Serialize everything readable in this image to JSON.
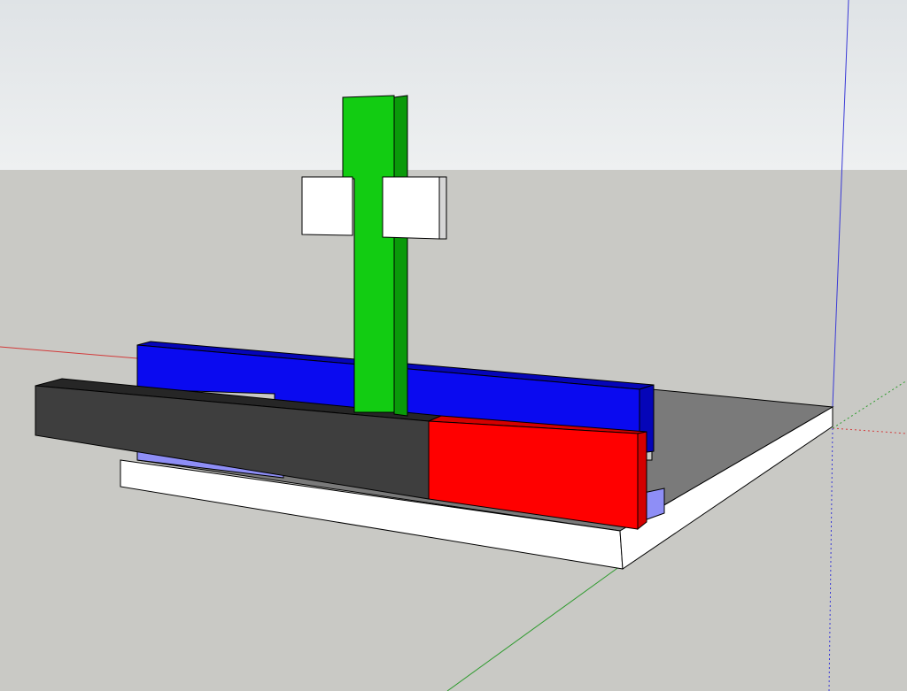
{
  "view": {
    "sky_top": "#dfe3e6",
    "sky_bottom": "#eef0f1",
    "ground": "#c9c9c5"
  },
  "axes": {
    "red_axis": "#d23a3a",
    "green_axis": "#2e9b2e",
    "blue_axis": "#3a3ad6"
  },
  "model": {
    "base_plate": {
      "top": "#7a7a7a",
      "side": "#ffffff"
    },
    "light_blue_rail": "#8e8ef6",
    "blue_bar": {
      "front": "#0a0af0",
      "top": "#0505b8"
    },
    "dark_bar": {
      "front": "#3e3e3e",
      "top": "#262626"
    },
    "red_block": {
      "front": "#ff0000",
      "top": "#d40000"
    },
    "green_post": {
      "front": "#12cc12",
      "side": "#0a9a0a"
    },
    "white_blocks": {
      "front": "#ffffff",
      "side": "#d6d6d6"
    }
  }
}
